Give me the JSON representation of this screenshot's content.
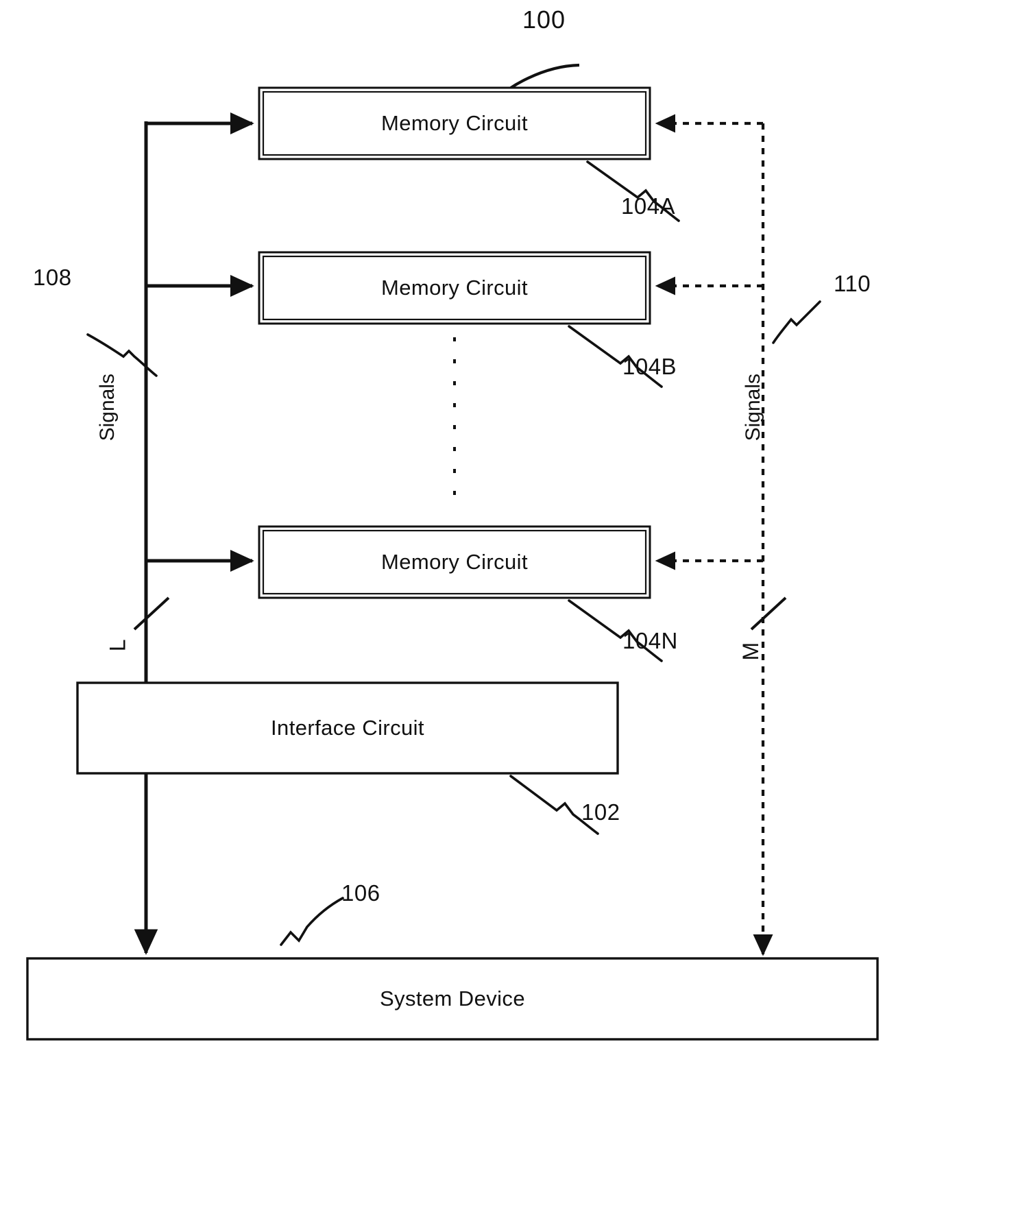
{
  "figure": {
    "number": "100",
    "type": "patent-block-diagram"
  },
  "blocks": {
    "memory_a": {
      "label": "Memory Circuit",
      "ref": "104A"
    },
    "memory_b": {
      "label": "Memory Circuit",
      "ref": "104B"
    },
    "memory_n": {
      "label": "Memory Circuit",
      "ref": "104N"
    },
    "interface": {
      "label": "Interface Circuit",
      "ref": "102"
    },
    "system": {
      "label": "System Device",
      "ref": "106"
    }
  },
  "buses": {
    "left": {
      "signals_label": "Signals",
      "ref": "108",
      "width_label": "L"
    },
    "right": {
      "signals_label": "Signals",
      "ref": "110",
      "width_label": "M"
    }
  },
  "colors": {
    "ink": "#111111",
    "background": "#ffffff"
  }
}
